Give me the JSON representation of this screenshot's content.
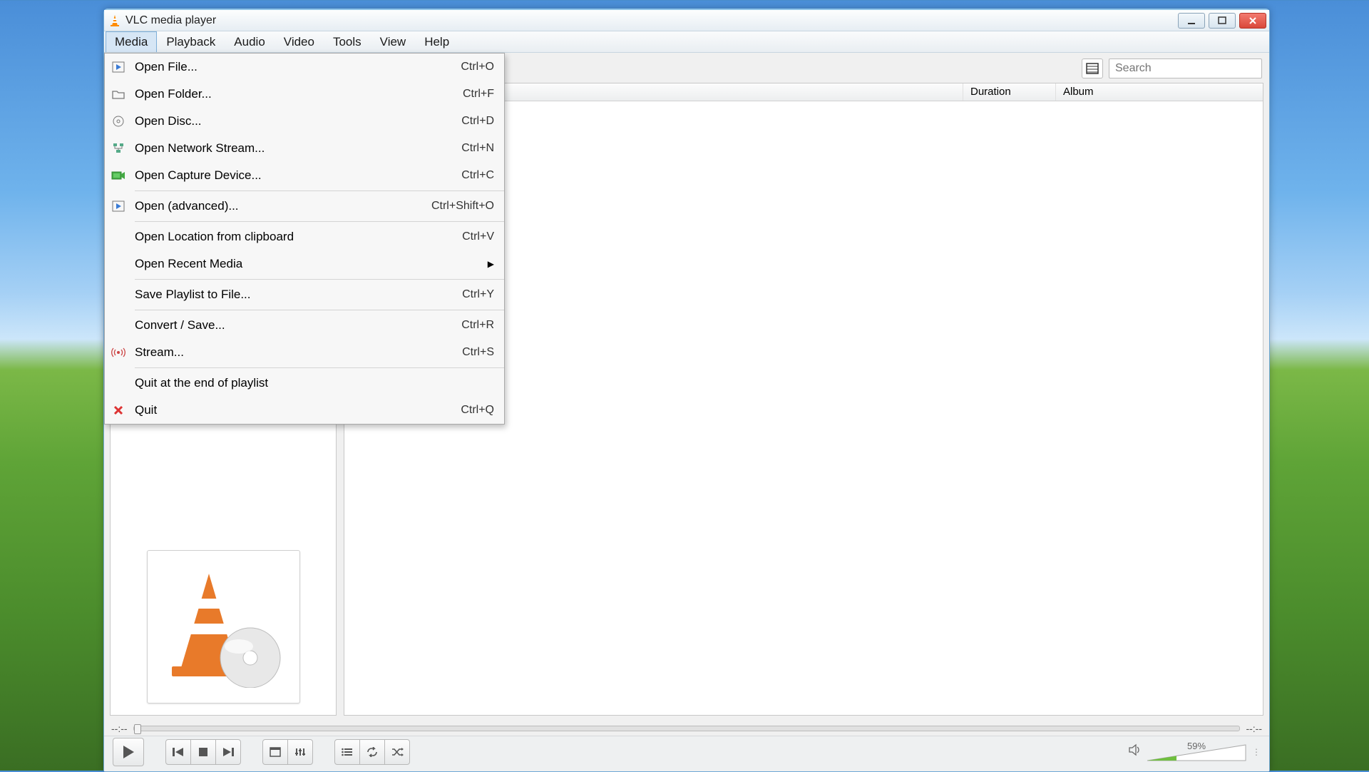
{
  "title": "VLC media player",
  "menubar": [
    "Media",
    "Playback",
    "Audio",
    "Video",
    "Tools",
    "View",
    "Help"
  ],
  "media_menu": [
    {
      "icon": "play-file",
      "label": "Open File...",
      "shortcut": "Ctrl+O"
    },
    {
      "icon": "folder",
      "label": "Open Folder...",
      "shortcut": "Ctrl+F"
    },
    {
      "icon": "disc",
      "label": "Open Disc...",
      "shortcut": "Ctrl+D"
    },
    {
      "icon": "network",
      "label": "Open Network Stream...",
      "shortcut": "Ctrl+N"
    },
    {
      "icon": "capture",
      "label": "Open Capture Device...",
      "shortcut": "Ctrl+C"
    },
    {
      "sep": true
    },
    {
      "icon": "play-file",
      "label": "Open (advanced)...",
      "shortcut": "Ctrl+Shift+O"
    },
    {
      "sep": true
    },
    {
      "icon": "",
      "label": "Open Location from clipboard",
      "shortcut": "Ctrl+V"
    },
    {
      "icon": "",
      "label": "Open Recent Media",
      "submenu": true
    },
    {
      "sep": true
    },
    {
      "icon": "",
      "label": "Save Playlist to File...",
      "shortcut": "Ctrl+Y"
    },
    {
      "sep": true
    },
    {
      "icon": "",
      "label": "Convert / Save...",
      "shortcut": "Ctrl+R"
    },
    {
      "icon": "stream",
      "label": "Stream...",
      "shortcut": "Ctrl+S"
    },
    {
      "sep": true
    },
    {
      "icon": "",
      "label": "Quit at the end of playlist"
    },
    {
      "icon": "quit",
      "label": "Quit",
      "shortcut": "Ctrl+Q"
    }
  ],
  "search_placeholder": "Search",
  "columns": {
    "title": "",
    "duration": "Duration",
    "album": "Album"
  },
  "time_left": "--:--",
  "time_right": "--:--",
  "volume_pct": "59%"
}
